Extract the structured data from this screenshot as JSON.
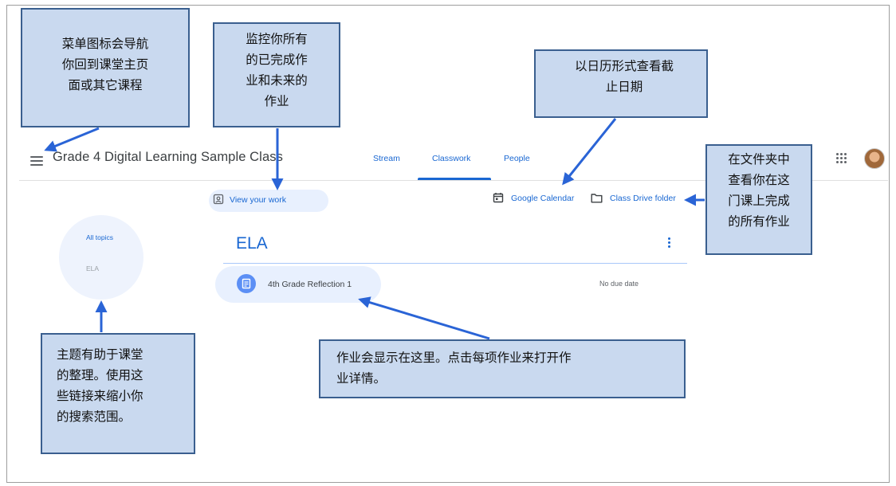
{
  "app": {
    "class_title": "Grade 4 Digital Learning Sample Class",
    "tabs": [
      {
        "label": "Stream",
        "active": false
      },
      {
        "label": "Classwork",
        "active": true
      },
      {
        "label": "People",
        "active": false
      }
    ]
  },
  "toolbar": {
    "view_work_label": "View your work",
    "calendar_label": "Google Calendar",
    "drive_label": "Class Drive folder"
  },
  "topics": {
    "items": [
      {
        "label": "All topics",
        "active": true
      },
      {
        "label": "ELA",
        "active": false
      }
    ]
  },
  "section": {
    "heading": "ELA",
    "assignments": [
      {
        "title": "4th Grade Reflection 1",
        "due": "No due date"
      }
    ]
  },
  "annotations": {
    "menu": "菜单图标会导航\n你回到课堂主页\n面或其它课程",
    "view_work": "监控你所有\n的已完成作\n业和未来的\n作业",
    "calendar": "以日历形式查看截\n止日期",
    "drive": "在文件夹中\n查看你在这\n门课上完成\n的所有作业",
    "topics": "主题有助于课堂\n的整理。使用这\n些链接来缩小你\n的搜索范围。",
    "assignments": "作业会显示在这里。点击每项作业来打开作\n业详情。"
  },
  "colors": {
    "accent": "#1967d2",
    "callout_fill": "#c9d9ef",
    "callout_border": "#3a5f8f",
    "arrow": "#2a64d6"
  },
  "icons": {
    "menu": "hamburger-icon",
    "apps": "apps-grid-icon",
    "view_work": "assignment-ind-icon",
    "calendar": "calendar-icon",
    "drive": "folder-icon",
    "more": "more-vert-icon",
    "assignment": "assignment-icon"
  }
}
